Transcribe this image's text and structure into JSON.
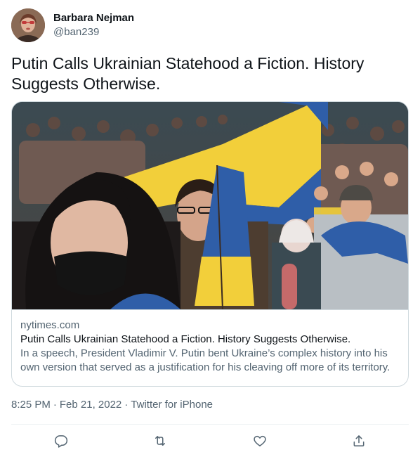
{
  "author": {
    "display_name": "Barbara Nejman",
    "handle": "@ban239"
  },
  "tweet": {
    "text": "Putin Calls Ukrainian Statehood a Fiction. History Suggests Otherwise."
  },
  "card": {
    "domain": "nytimes.com",
    "title": "Putin Calls Ukrainian Statehood a Fiction. History Suggests Otherwise.",
    "description": "In a speech, President Vladimir V. Putin bent Ukraine’s complex history into his own version that served as a justification for his cleaving off more of its territory."
  },
  "meta": {
    "time": "8:25 PM",
    "separator": "·",
    "date": "Feb 21, 2022",
    "source": "Twitter for iPhone"
  },
  "actions": {
    "reply_icon": "reply-icon",
    "retweet_icon": "retweet-icon",
    "like_icon": "like-icon",
    "share_icon": "share-icon"
  },
  "colors": {
    "text_primary": "#0f1419",
    "text_secondary": "#536471",
    "border": "#cfd9de",
    "flag_blue": "#2f5ea8",
    "flag_yellow": "#f2cf3a"
  }
}
